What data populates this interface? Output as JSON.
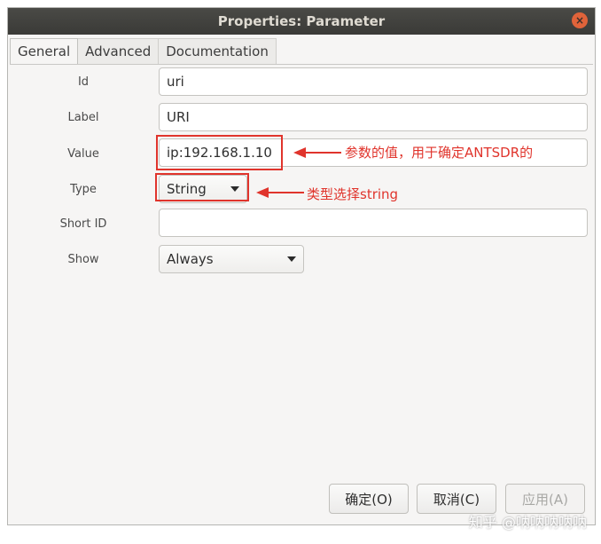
{
  "window": {
    "title": "Properties: Parameter",
    "close_icon": "×"
  },
  "tabs": [
    {
      "label": "General"
    },
    {
      "label": "Advanced"
    },
    {
      "label": "Documentation"
    }
  ],
  "form": {
    "id": {
      "label": "Id",
      "value": "uri"
    },
    "label": {
      "label": "Label",
      "value": "URI"
    },
    "value": {
      "label": "Value",
      "value": "ip:192.168.1.10"
    },
    "type": {
      "label": "Type",
      "value": "String"
    },
    "short_id": {
      "label": "Short ID",
      "value": ""
    },
    "show": {
      "label": "Show",
      "value": "Always"
    }
  },
  "annotations": {
    "value_note": "参数的值，用于确定ANTSDR的",
    "type_note": "类型选择string"
  },
  "buttons": {
    "ok": "确定(O)",
    "cancel": "取消(C)",
    "apply": "应用(A)"
  },
  "watermark": "知乎 @呐呐呐呐呐",
  "colors": {
    "annotation": "#e0342c",
    "titlebar": "#3a3a37"
  }
}
